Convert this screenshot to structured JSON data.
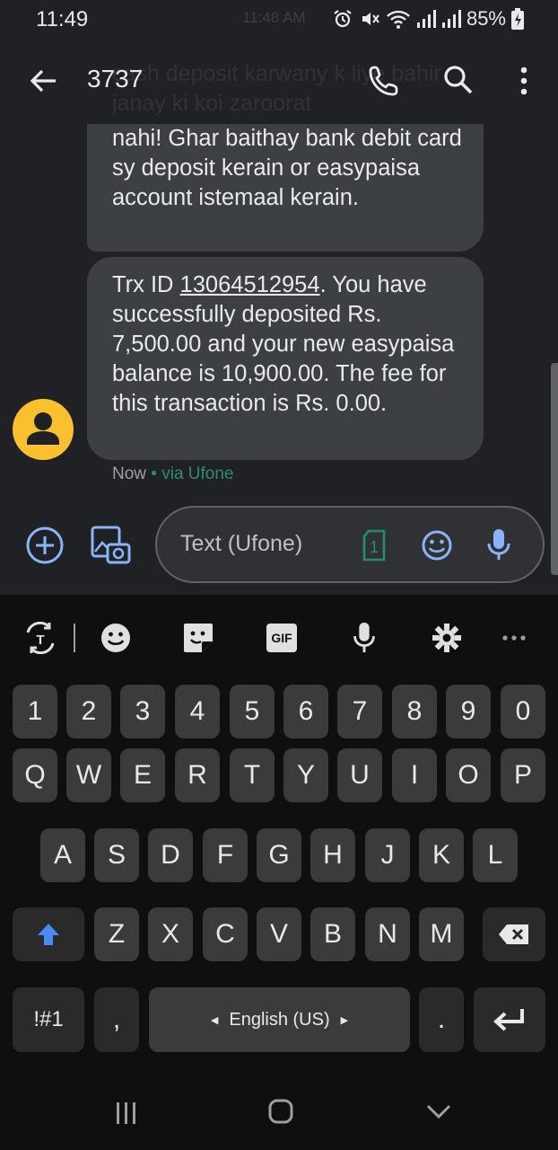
{
  "status": {
    "time": "11:49",
    "ghost_time": "11:48 AM",
    "battery": "85%"
  },
  "app_bar": {
    "title": "3737",
    "ghost_text": "cash deposit karwany k liye bahir janay ki koi zaroorat"
  },
  "messages": {
    "m1": "nahi! Ghar baithay bank debit card sy deposit kerain or easypaisa account istemaal kerain.",
    "m2_pre": "Trx ID ",
    "m2_trx": "13064512954",
    "m2_post": ". You have successfully deposited Rs. 7,500.00 and your new easypaisa balance is 10,900.00. The fee for this transaction is Rs. 0.00."
  },
  "meta": {
    "time": "Now",
    "sep": " • ",
    "via": "via Ufone"
  },
  "compose": {
    "placeholder": "Text (Ufone)",
    "sim": "1"
  },
  "keyboard": {
    "toolbar": [
      "translate-icon",
      "emoji-icon",
      "sticker-icon",
      "GIF",
      "mic-icon",
      "settings-icon",
      "more-icon"
    ],
    "row_numbers": [
      "1",
      "2",
      "3",
      "4",
      "5",
      "6",
      "7",
      "8",
      "9",
      "0"
    ],
    "row_q": [
      "Q",
      "W",
      "E",
      "R",
      "T",
      "Y",
      "U",
      "I",
      "O",
      "P"
    ],
    "row_a": [
      "A",
      "S",
      "D",
      "F",
      "G",
      "H",
      "J",
      "K",
      "L"
    ],
    "row_z": [
      "Z",
      "X",
      "C",
      "V",
      "B",
      "N",
      "M"
    ],
    "symbols": "!#1",
    "comma": ",",
    "space": "English (US)",
    "period": "."
  },
  "colors": {
    "bubble": "#3c4043",
    "accent": "#8ab4f8",
    "avatar": "#fbc02d",
    "via": "#2e8b7a"
  }
}
